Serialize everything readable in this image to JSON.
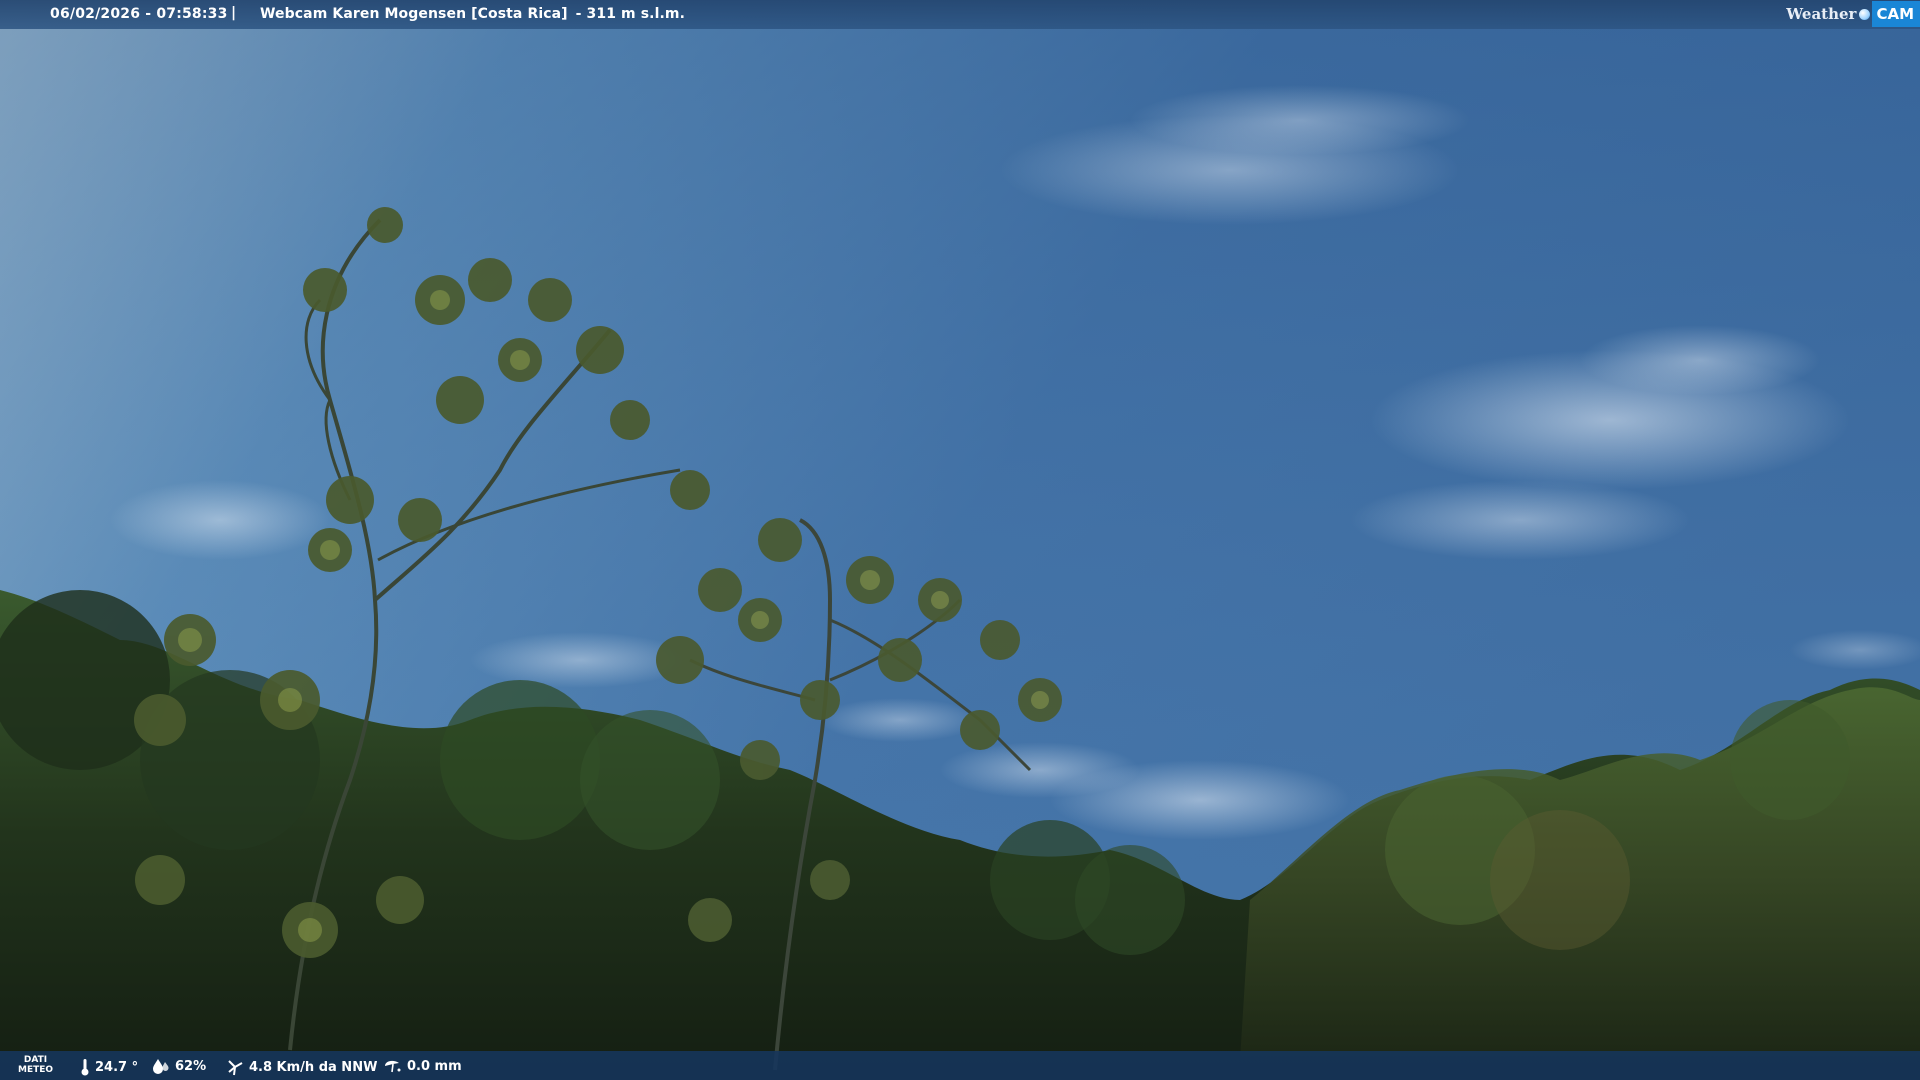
{
  "header": {
    "timestamp": "06/02/2026 - 07:58:33",
    "separator": "|",
    "title": "Webcam Karen Mogensen [Costa Rica]",
    "altitude": "- 311 m s.l.m."
  },
  "logo": {
    "word": "Weather",
    "cam": "CAM"
  },
  "weather": {
    "label_line1": "DATI",
    "label_line2": "METEO",
    "temperature": "24.7 °",
    "humidity": "62%",
    "wind": "4.8 Km/h da NNW",
    "rain": "0.0 mm"
  },
  "icons": {
    "temperature": "thermometer-icon",
    "humidity": "humidity-icon",
    "wind": "wind-icon",
    "rain": "rain-icon"
  },
  "colors": {
    "sky_top": "#3a6da6",
    "sky_left": "#8fb3cf",
    "foliage_dark": "#1c2a1a",
    "foliage_mid": "#3a5a2a",
    "bar_background": "#1f4f82",
    "logo_blue": "#1a86d6"
  }
}
